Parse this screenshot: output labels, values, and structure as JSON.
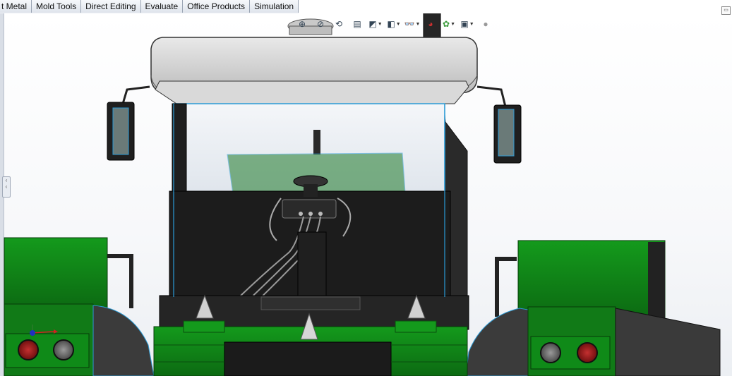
{
  "command_manager": {
    "tabs": [
      {
        "label": "t Metal"
      },
      {
        "label": "Mold Tools"
      },
      {
        "label": "Direct Editing"
      },
      {
        "label": "Evaluate"
      },
      {
        "label": "Office Products"
      },
      {
        "label": "Simulation"
      }
    ]
  },
  "heads_up_toolbar": {
    "icons": [
      "zoom-to-fit-icon",
      "zoom-to-area-icon",
      "previous-view-icon",
      "section-view-icon",
      "view-orientation-icon",
      "display-style-icon",
      "hide-show-items-icon",
      "edit-appearance-icon",
      "apply-scene-icon",
      "view-settings-icon",
      "display-toggle-icon"
    ]
  },
  "colors": {
    "tractor_green": "#117a17",
    "dark_green": "#0b5a10",
    "panel_black": "#1c1c1c",
    "cab_roof": "#d6d6d6",
    "glass": "#eef2f6",
    "light_red": "#9c1b1b",
    "edge_blue": "#2b9bd6"
  }
}
